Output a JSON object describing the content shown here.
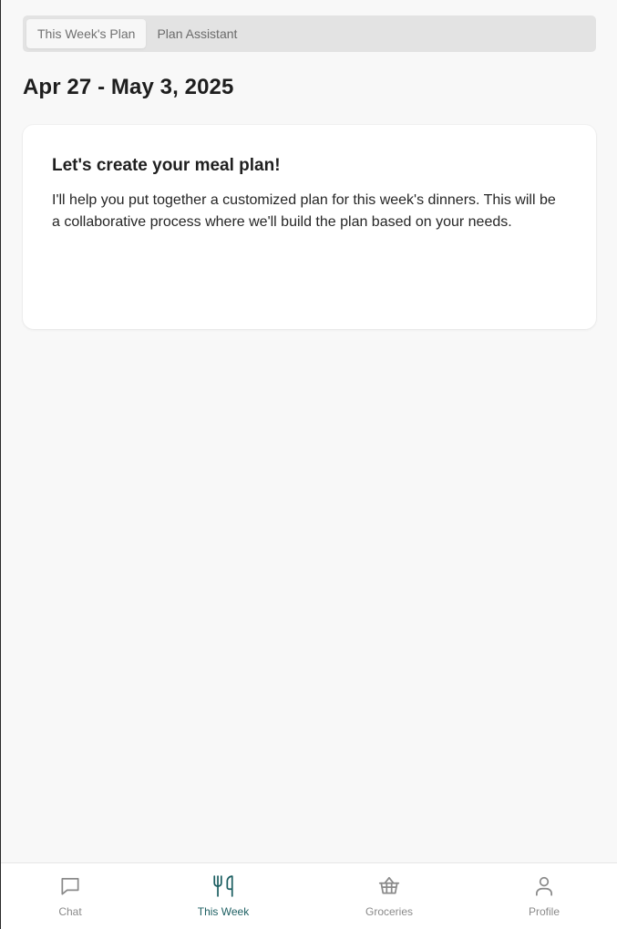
{
  "tabs": [
    {
      "label": "This Week's Plan",
      "active": true
    },
    {
      "label": "Plan Assistant",
      "active": false
    }
  ],
  "week": {
    "title": "Apr 27 - May 3, 2025"
  },
  "card": {
    "heading": "Let's create your meal plan!",
    "body": "I'll help you put together a customized plan for this week's dinners. This will be a collaborative process where we'll build the plan based on your needs."
  },
  "nav": {
    "items": [
      {
        "label": "Chat",
        "icon": "chat-bubble-icon",
        "active": false
      },
      {
        "label": "This Week",
        "icon": "utensils-icon",
        "active": true
      },
      {
        "label": "Groceries",
        "icon": "shopping-basket-icon",
        "active": false
      },
      {
        "label": "Profile",
        "icon": "user-icon",
        "active": false
      }
    ]
  },
  "colors": {
    "accent": "#1d5f62",
    "background": "#f8f8f8",
    "inactive": "#8a8a8a"
  }
}
